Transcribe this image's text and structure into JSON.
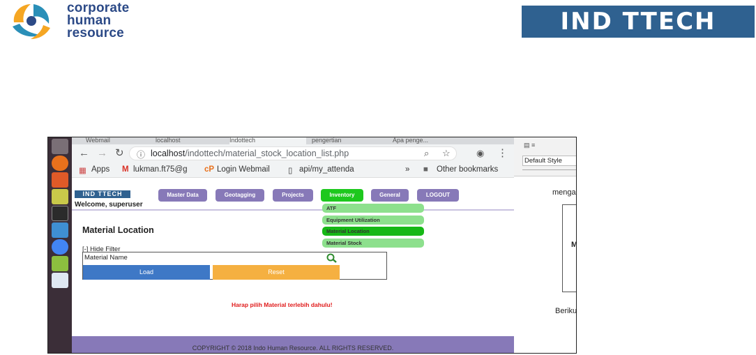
{
  "header": {
    "left_logo_lines": [
      "corporate",
      "human",
      "resource"
    ],
    "right_logo_text": "IND TTECH"
  },
  "browser": {
    "tabs": [
      "Webmail",
      "localhost",
      "Indottech",
      "pengertian",
      "Apa penge..."
    ],
    "url_host": "localhost",
    "url_path": "/indottech/material_stock_location_list.php",
    "bookmarks": {
      "apps": "Apps",
      "gmail": "lukman.ft75@g",
      "webmail": "Login Webmail",
      "api": "api/my_attenda",
      "more": "»",
      "other": "Other bookmarks"
    }
  },
  "site": {
    "logo": "IND TTECH",
    "welcome": "Welcome, superuser",
    "menu": [
      "Master Data",
      "Geotagging",
      "Projects",
      "Inventory",
      "General",
      "LOGOUT"
    ],
    "dropdown": [
      "ATF",
      "Equipment Utilization",
      "Material Location",
      "Material Stock"
    ],
    "page_title": "Material Location",
    "hide_filter": "[-] Hide Filter",
    "filter_label": "Material Name",
    "load_label": "Load",
    "reset_label": "Reset",
    "alert": "Harap pilih Material terlebih dahulu!",
    "footer": "COPYRIGHT © 2018 Indo Human Resource. ALL RIGHTS RESERVED."
  },
  "doc": {
    "style": "Default Style",
    "words": [
      "menga",
      "M",
      "Beriku"
    ]
  },
  "colors": {
    "menu": "#8779b8",
    "menu_active": "#1ec81e",
    "dropdown": "#8de08d",
    "dropdown_active": "#16b816",
    "load": "#3e78c6",
    "reset": "#f5b041",
    "alert": "#e01b1b",
    "brand": "#2f6190"
  }
}
